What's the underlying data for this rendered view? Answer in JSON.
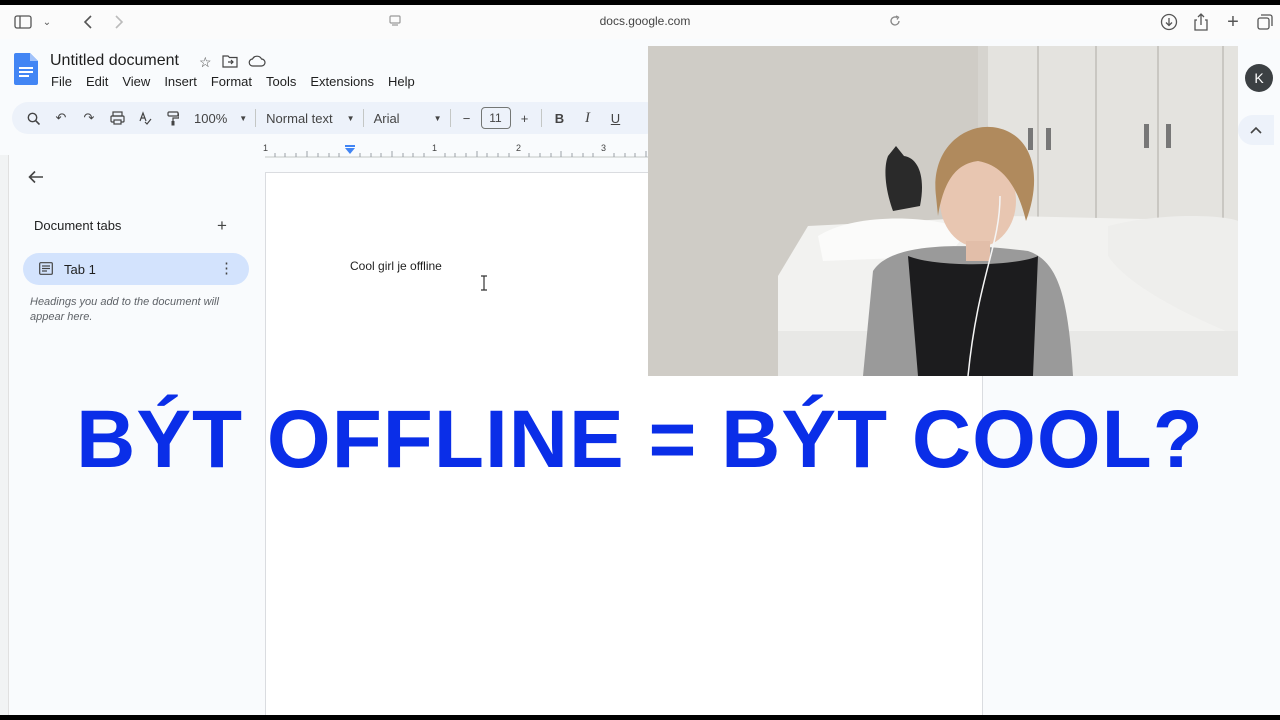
{
  "browser": {
    "url": "docs.google.com"
  },
  "document": {
    "title": "Untitled document",
    "menu": [
      "File",
      "Edit",
      "View",
      "Insert",
      "Format",
      "Tools",
      "Extensions",
      "Help"
    ],
    "toolbar": {
      "zoom": "100%",
      "style": "Normal text",
      "font": "Arial",
      "font_size": "11",
      "bold": "B",
      "italic": "I",
      "underline": "U",
      "minus": "−",
      "plus": "+"
    },
    "ruler_labels": [
      "1",
      "1",
      "2",
      "3"
    ],
    "body_text": "Cool girl je offline"
  },
  "sidebar": {
    "title": "Document tabs",
    "tabs": [
      {
        "label": "Tab 1"
      }
    ],
    "hint": "Headings you add to the document will appear here."
  },
  "user": {
    "avatar_letter": "K"
  },
  "overlay": {
    "headline": "BÝT OFFLINE = BÝT COOL?",
    "color": "#0a2ee8"
  }
}
